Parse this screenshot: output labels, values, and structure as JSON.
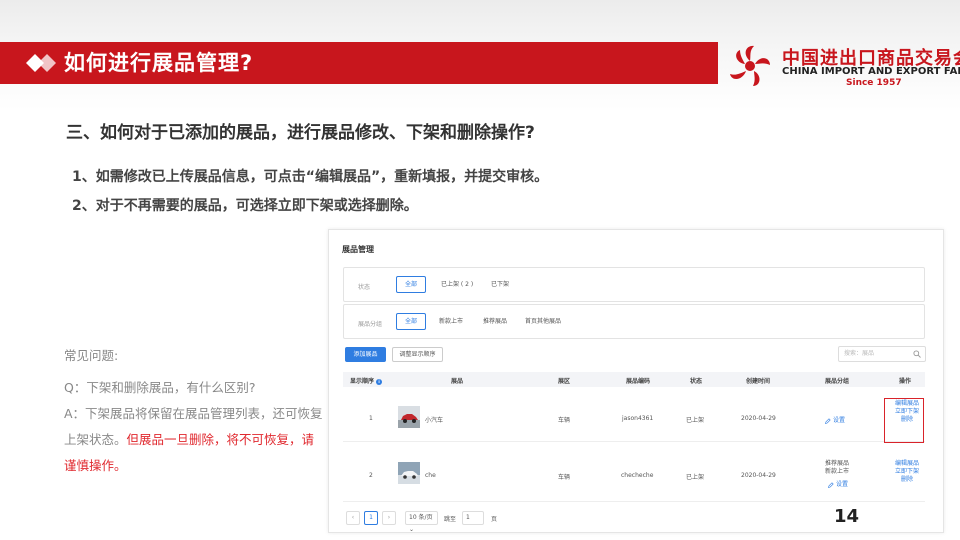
{
  "banner": {
    "title": "如何进行展品管理?"
  },
  "logo": {
    "cn": "中国进出口商品交易会",
    "en": "CHINA IMPORT AND EXPORT FAIR",
    "since": "Since 1957"
  },
  "heading": "三、如何对于已添加的展品，进行展品修改、下架和删除操作?",
  "steps": [
    "1、如需修改已上传展品信息，可点击“编辑展品”，重新填报，并提交审核。",
    "2、对于不再需要的展品，可选择立即下架或选择删除。"
  ],
  "faq": {
    "title": "常见问题:",
    "q": "Q：下架和删除展品，有什么区别?",
    "a_normal": "A：下架展品将保留在展品管理列表，还可恢复上架状态。",
    "a_red": "但展品一旦删除，将不可恢复，请谨慎操作。"
  },
  "page_number": "14",
  "screenshot": {
    "title": "展品管理",
    "filters": {
      "status_label": "状态",
      "status_options": [
        "全部",
        "已上架 ( 2 )",
        "已下架"
      ],
      "group_label": "展品分组",
      "group_options": [
        "全部",
        "新款上市",
        "推荐展品",
        "首页其他展品"
      ]
    },
    "buttons": {
      "add": "添加展品",
      "reorder": "调整显示顺序"
    },
    "search_placeholder": "搜索：展品",
    "columns": [
      "显示顺序",
      "展品",
      "展区",
      "展品编码",
      "状态",
      "创建时间",
      "展品分组",
      "操作"
    ],
    "rows": [
      {
        "order": "1",
        "name": "小汽车",
        "zone": "车辆",
        "code": "jason4361",
        "status": "已上架",
        "date": "2020-04-29",
        "group": "",
        "group_link": "设置",
        "ops": [
          "编辑展品",
          "立即下架",
          "删除"
        ]
      },
      {
        "order": "2",
        "name": "che",
        "zone": "车辆",
        "code": "checheche",
        "status": "已上架",
        "date": "2020-04-29",
        "group": "推荐展品\n新款上市",
        "group_link": "设置",
        "ops": [
          "编辑展品",
          "立即下架",
          "删除"
        ]
      }
    ],
    "pager": {
      "prev": "‹",
      "current": "1",
      "next": "›",
      "page_size": "10 条/页",
      "jump_label": "跳至",
      "jump_value": "1",
      "unit": "页"
    }
  }
}
